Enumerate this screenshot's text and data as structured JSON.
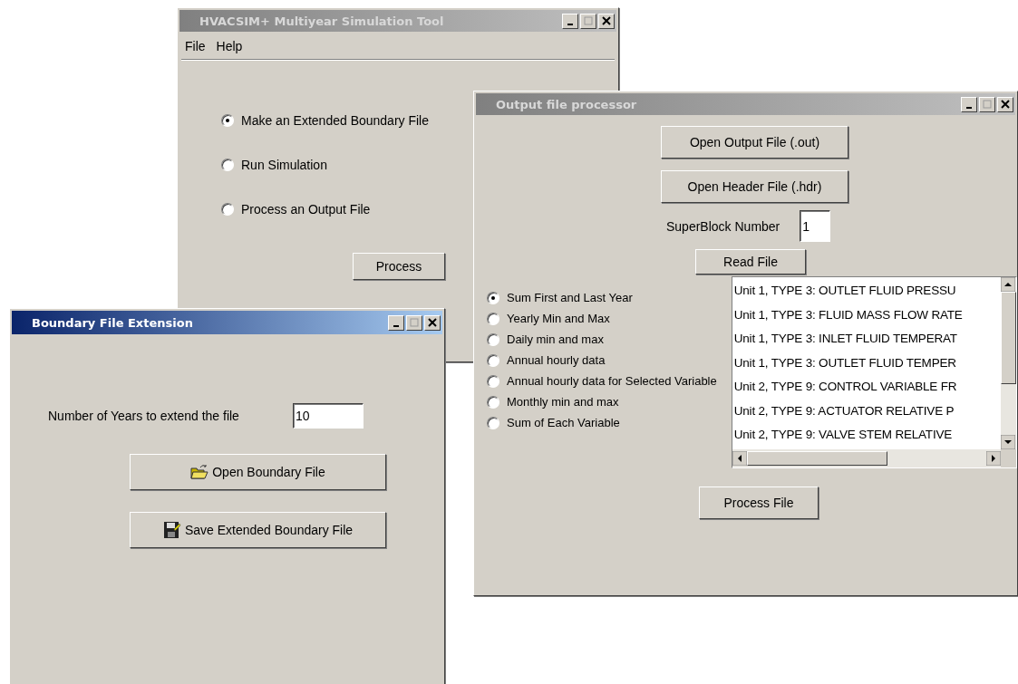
{
  "main_window": {
    "title": "HVACSIM+ Multiyear Simulation Tool",
    "active": false,
    "menu": [
      "File",
      "Help"
    ],
    "options": [
      {
        "label": "Make an Extended Boundary File",
        "selected": true
      },
      {
        "label": "Run Simulation",
        "selected": false
      },
      {
        "label": "Process an Output File",
        "selected": false
      }
    ],
    "button": "Process"
  },
  "output_processor": {
    "title": "Output file processor",
    "active": false,
    "open_output_button": "Open Output File (.out)",
    "open_header_button": "Open Header File (.hdr)",
    "superblock": {
      "label": "SuperBlock Number",
      "value": "1"
    },
    "read_button": "Read File",
    "options": [
      {
        "label": "Sum First and Last Year",
        "selected": true
      },
      {
        "label": "Yearly Min and Max",
        "selected": false
      },
      {
        "label": "Daily min and max",
        "selected": false
      },
      {
        "label": "Annual hourly data",
        "selected": false
      },
      {
        "label": "Annual hourly data for Selected Variable",
        "selected": false
      },
      {
        "label": "Monthly min and max",
        "selected": false
      },
      {
        "label": "Sum of Each Variable",
        "selected": false
      }
    ],
    "variables": [
      "Unit 1, TYPE 3: OUTLET FLUID PRESSU",
      "Unit 1, TYPE 3: FLUID MASS FLOW RATE",
      "Unit 1, TYPE 3: INLET FLUID TEMPERAT",
      "Unit 1, TYPE 3: OUTLET FLUID TEMPER",
      "Unit 2, TYPE 9: CONTROL VARIABLE FR",
      "Unit 2, TYPE 9: ACTUATOR RELATIVE P",
      "Unit 2, TYPE 9: VALVE STEM RELATIVE"
    ],
    "process_button": "Process File"
  },
  "boundary_extension": {
    "title": "Boundary File Extension",
    "active": true,
    "years": {
      "label": "Number of Years to extend the file",
      "value": "10"
    },
    "open_button": "Open Boundary File",
    "save_button": "Save Extended Boundary File"
  }
}
